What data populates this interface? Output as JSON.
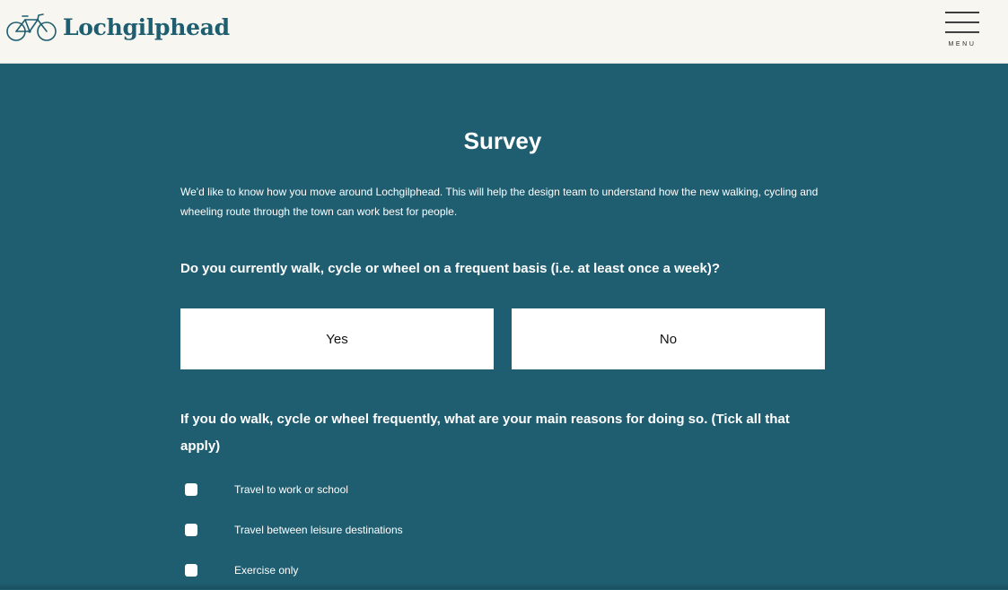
{
  "header": {
    "site_name": "Lochgilphead",
    "logo_icon": "bicycle-icon",
    "menu_icon": "hamburger-icon",
    "menu_label": "MENU"
  },
  "survey": {
    "title": "Survey",
    "intro": "We'd like to know how you move around Lochgilphead. This will help the design team to understand how the new walking, cycling and wheeling route through the town can work best for people.",
    "question_1": "Do you currently walk, cycle or wheel on a frequent basis (i.e. at least once a week)?",
    "answers": [
      "Yes",
      "No"
    ],
    "question_2": "If you do walk, cycle or wheel frequently, what are your main reasons for doing so. (Tick all that apply)",
    "options": [
      "Travel to work or school",
      "Travel between leisure destinations",
      "Exercise only"
    ]
  },
  "colors": {
    "header_bg": "#f7f6f0",
    "brand": "#1f5e70",
    "page_bg": "#1f5e70",
    "text_on_dark": "#ffffff"
  }
}
